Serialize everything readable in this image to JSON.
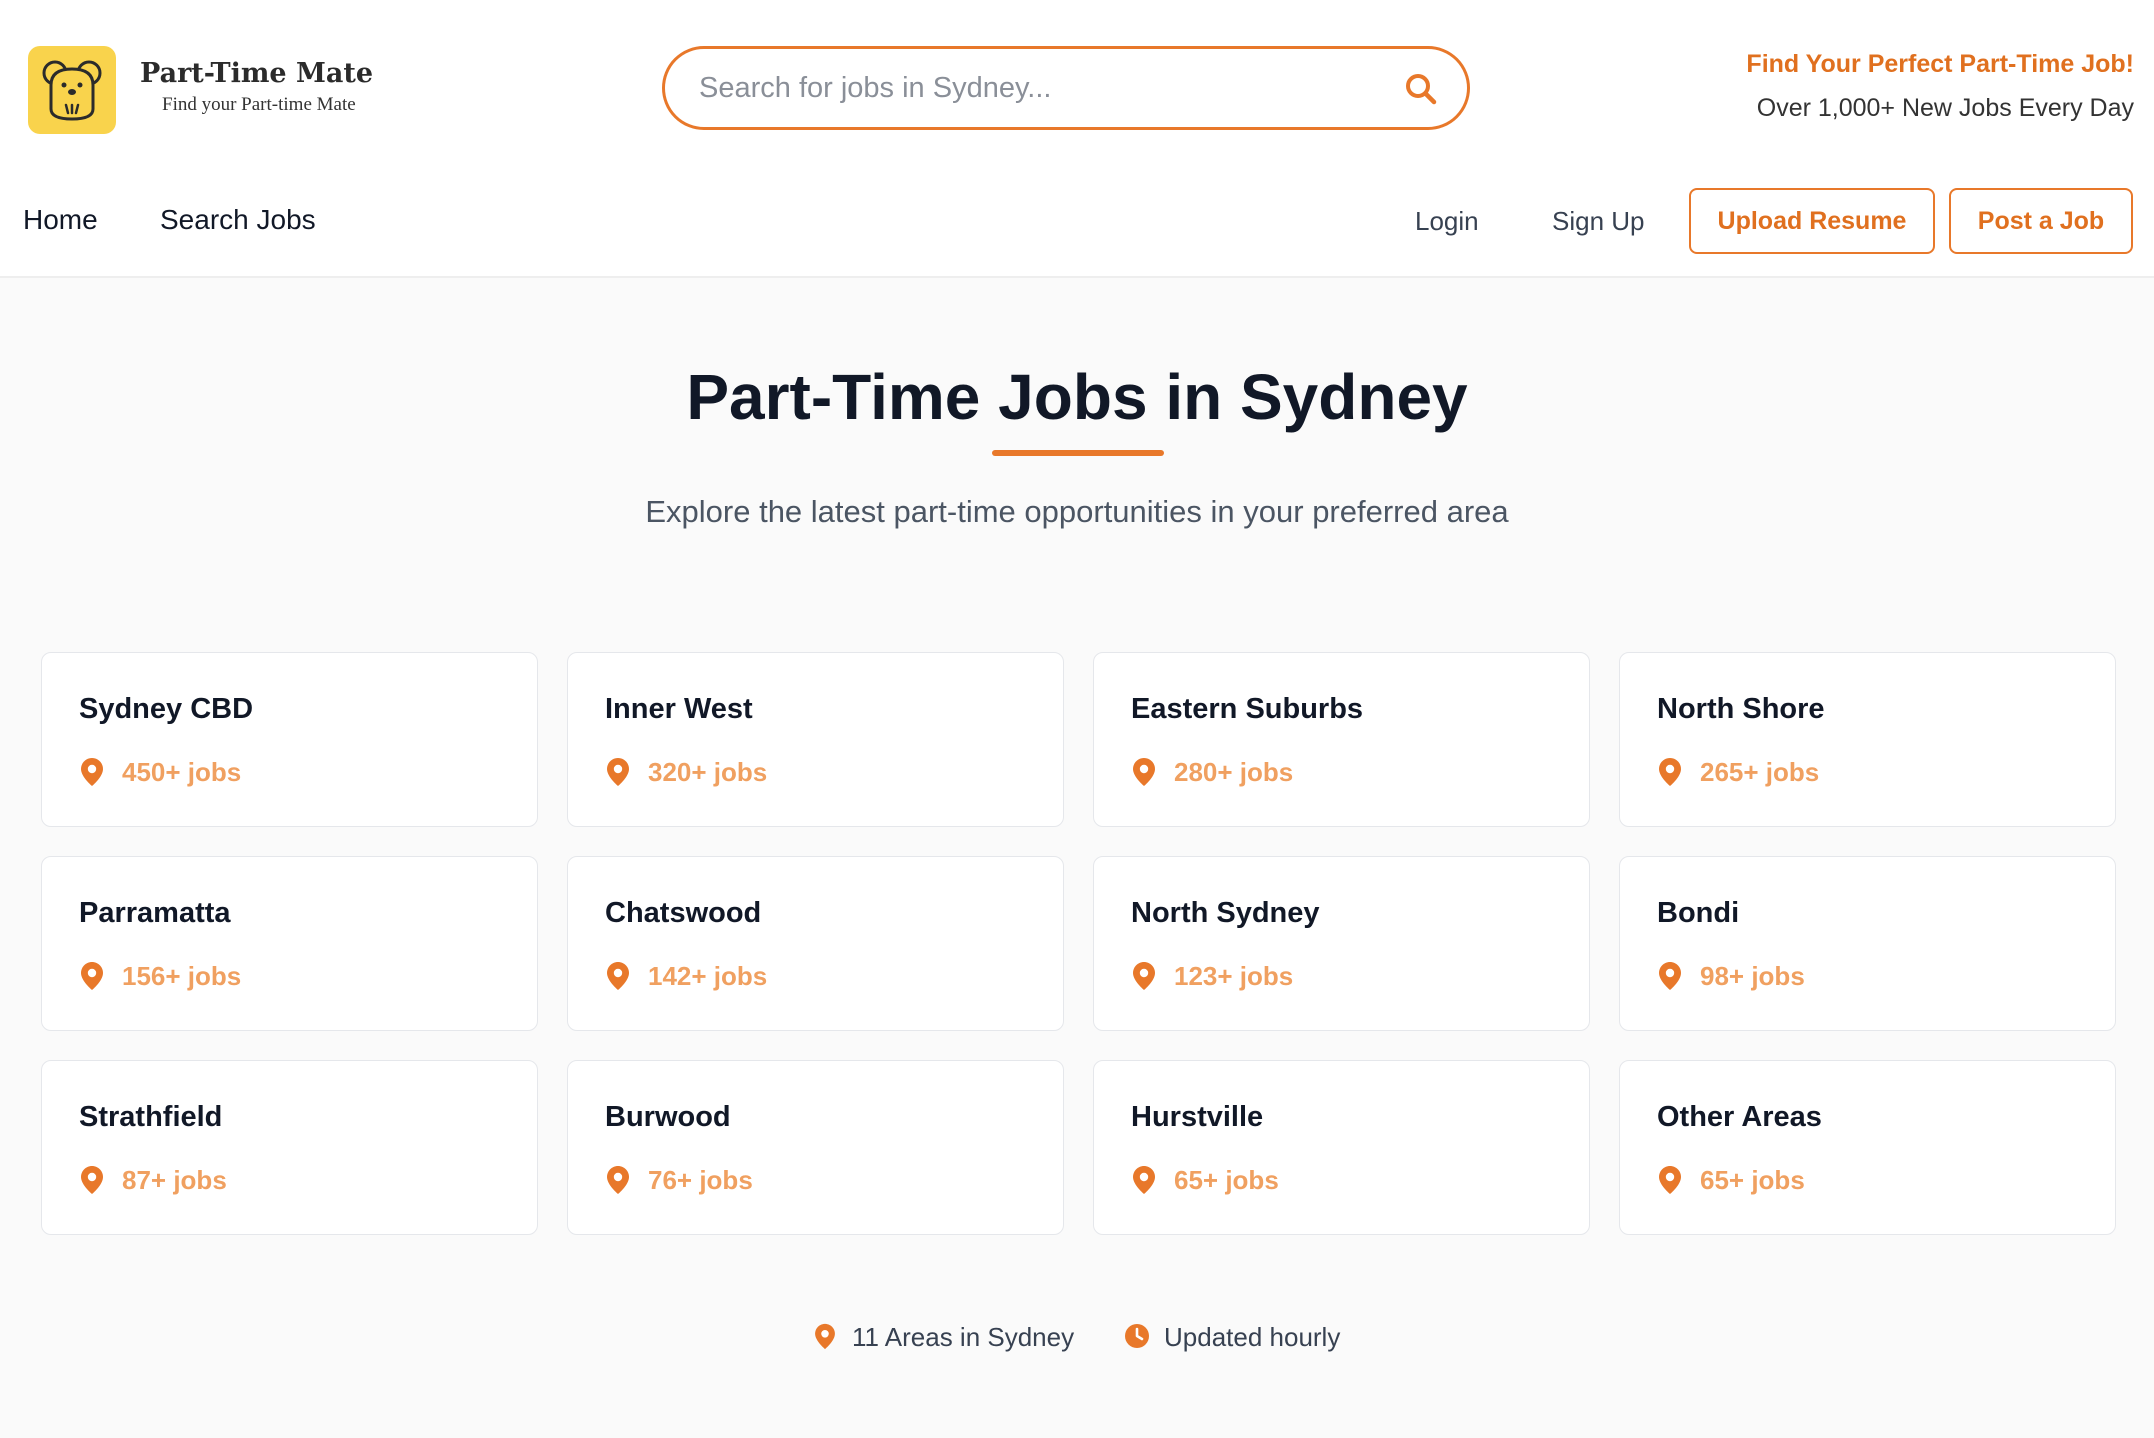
{
  "header": {
    "brand_name": "Part-Time Mate",
    "brand_tagline": "Find your Part-time Mate",
    "search_placeholder": "Search for jobs in Sydney...",
    "promo_title": "Find Your Perfect Part-Time Job!",
    "promo_subtitle": "Over 1,000+ New Jobs Every Day"
  },
  "nav": {
    "home": "Home",
    "search_jobs": "Search Jobs",
    "login": "Login",
    "sign_up": "Sign Up",
    "upload_resume": "Upload Resume",
    "post_job": "Post a Job"
  },
  "main": {
    "title": "Part-Time Jobs in Sydney",
    "subtitle": "Explore the latest part-time opportunities in your preferred area"
  },
  "areas": [
    {
      "name": "Sydney CBD",
      "count": "450+ jobs"
    },
    {
      "name": "Inner West",
      "count": "320+ jobs"
    },
    {
      "name": "Eastern Suburbs",
      "count": "280+ jobs"
    },
    {
      "name": "North Shore",
      "count": "265+ jobs"
    },
    {
      "name": "Parramatta",
      "count": "156+ jobs"
    },
    {
      "name": "Chatswood",
      "count": "142+ jobs"
    },
    {
      "name": "North Sydney",
      "count": "123+ jobs"
    },
    {
      "name": "Bondi",
      "count": "98+ jobs"
    },
    {
      "name": "Strathfield",
      "count": "87+ jobs"
    },
    {
      "name": "Burwood",
      "count": "76+ jobs"
    },
    {
      "name": "Hurstville",
      "count": "65+ jobs"
    },
    {
      "name": "Other Areas",
      "count": "65+ jobs"
    }
  ],
  "footer": {
    "areas_count": "11 Areas in Sydney",
    "update_freq": "Updated hourly"
  },
  "icons": {
    "logo": "koala-logo-icon",
    "search": "search-icon",
    "location": "map-pin-icon",
    "clock": "clock-icon"
  },
  "colors": {
    "accent": "#e8782a",
    "accent_light": "#f0a060",
    "logo_bg": "#f9d34c"
  }
}
